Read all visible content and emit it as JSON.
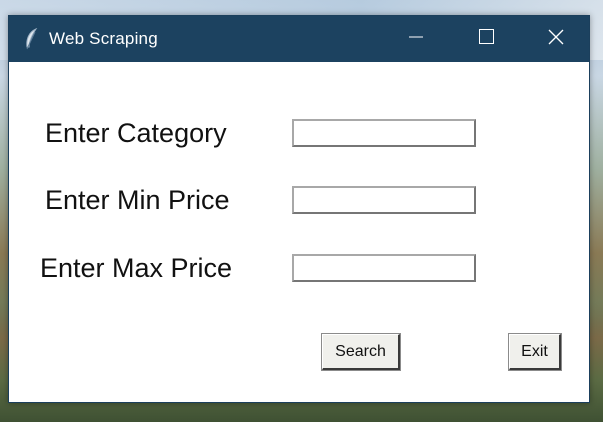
{
  "window": {
    "title": "Web Scraping",
    "titlebar_color": "#1c4260"
  },
  "titlebar_icons": {
    "app": "feather-icon",
    "minimize": "minimize-icon",
    "maximize": "maximize-icon",
    "close": "close-icon"
  },
  "form": {
    "category_label": "Enter Category",
    "category_value": "",
    "min_price_label": "Enter Min Price",
    "min_price_value": "",
    "max_price_label": "Enter Max Price",
    "max_price_value": ""
  },
  "buttons": {
    "search_label": "Search",
    "exit_label": "Exit"
  }
}
